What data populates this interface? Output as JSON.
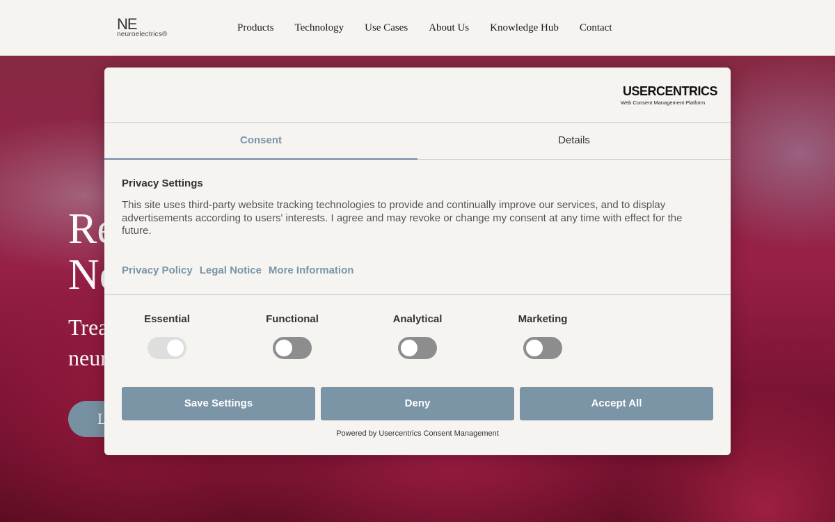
{
  "header": {
    "logo_mark": "NE",
    "logo_text": "neuroelectrics®",
    "nav": [
      "Products",
      "Technology",
      "Use Cases",
      "About Us",
      "Knowledge Hub",
      "Contact"
    ]
  },
  "hero": {
    "title_line1": "Re",
    "title_line2": "Ne",
    "subtitle_line1": "Trea",
    "subtitle_line2": "neur",
    "cta": "L"
  },
  "consent": {
    "brand_name": "USERCENTRICS",
    "brand_tagline": "Web Consent Management Platform",
    "tabs": [
      {
        "label": "Consent",
        "active": true
      },
      {
        "label": "Details",
        "active": false
      }
    ],
    "section_title": "Privacy Settings",
    "description": "This site uses third-party website tracking technologies to provide and continually improve our services, and to display advertisements according to users' interests. I agree and may revoke or change my consent at any time with effect for the future.",
    "links": [
      "Privacy Policy",
      "Legal Notice",
      "More Information"
    ],
    "categories": [
      {
        "label": "Essential",
        "enabled": true,
        "locked": true
      },
      {
        "label": "Functional",
        "enabled": false,
        "locked": false
      },
      {
        "label": "Analytical",
        "enabled": false,
        "locked": false
      },
      {
        "label": "Marketing",
        "enabled": false,
        "locked": false
      }
    ],
    "buttons": {
      "save": "Save Settings",
      "deny": "Deny",
      "accept": "Accept All"
    },
    "powered_by": "Powered by Usercentrics Consent Management"
  },
  "colors": {
    "accent": "#7b94a6",
    "modal_bg": "#f6f4f1",
    "toggle_off": "#8d8d8d"
  }
}
